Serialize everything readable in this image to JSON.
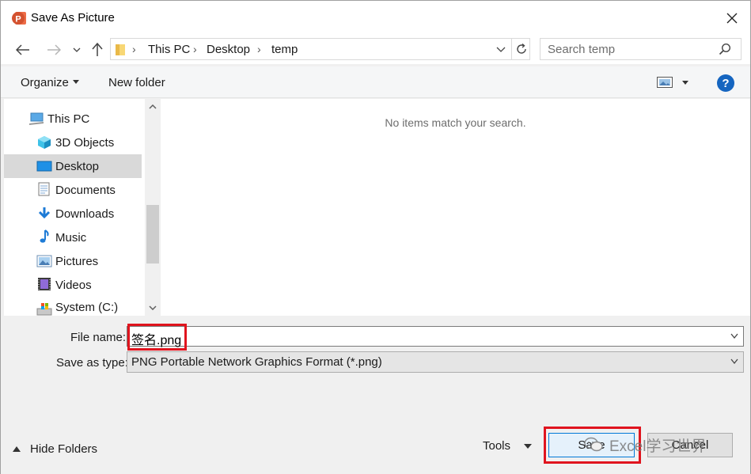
{
  "window": {
    "title": "Save As Picture",
    "app_icon": "powerpoint-icon",
    "close_glyph": "✕"
  },
  "nav": {
    "back_icon": "back-arrow-icon",
    "forward_icon": "forward-arrow-icon",
    "recent_icon": "chevron-down-icon",
    "up_icon": "up-arrow-icon",
    "breadcrumb": [
      "This PC",
      "Desktop",
      "temp"
    ],
    "search_placeholder": "Search temp"
  },
  "commands": {
    "organize": "Organize",
    "new_folder": "New folder",
    "view_icon": "picture-view-icon",
    "help": "?"
  },
  "sidebar": {
    "items": [
      {
        "label": "This PC",
        "icon": "computer-icon",
        "selected": false
      },
      {
        "label": "3D Objects",
        "icon": "3d-cube-icon",
        "selected": false
      },
      {
        "label": "Desktop",
        "icon": "desktop-icon",
        "selected": true
      },
      {
        "label": "Documents",
        "icon": "document-icon",
        "selected": false
      },
      {
        "label": "Downloads",
        "icon": "download-icon",
        "selected": false
      },
      {
        "label": "Music",
        "icon": "music-note-icon",
        "selected": false
      },
      {
        "label": "Pictures",
        "icon": "pictures-icon",
        "selected": false
      },
      {
        "label": "Videos",
        "icon": "film-icon",
        "selected": false
      },
      {
        "label": "System (C:)",
        "icon": "drive-icon",
        "selected": false
      }
    ]
  },
  "content": {
    "empty_message": "No items match your search."
  },
  "form": {
    "file_name_label": "File name:",
    "file_name_value": "签名.png",
    "save_type_label": "Save as type:",
    "save_type_value": "PNG Portable Network Graphics Format (*.png)"
  },
  "footer": {
    "hide_folders": "Hide Folders",
    "tools": "Tools",
    "save": "Save",
    "cancel": "Cancel",
    "watermark": "Excel学习世界"
  },
  "colors": {
    "highlight": "#e0141e",
    "accent": "#0078d7",
    "help_blue": "#1565c0"
  }
}
